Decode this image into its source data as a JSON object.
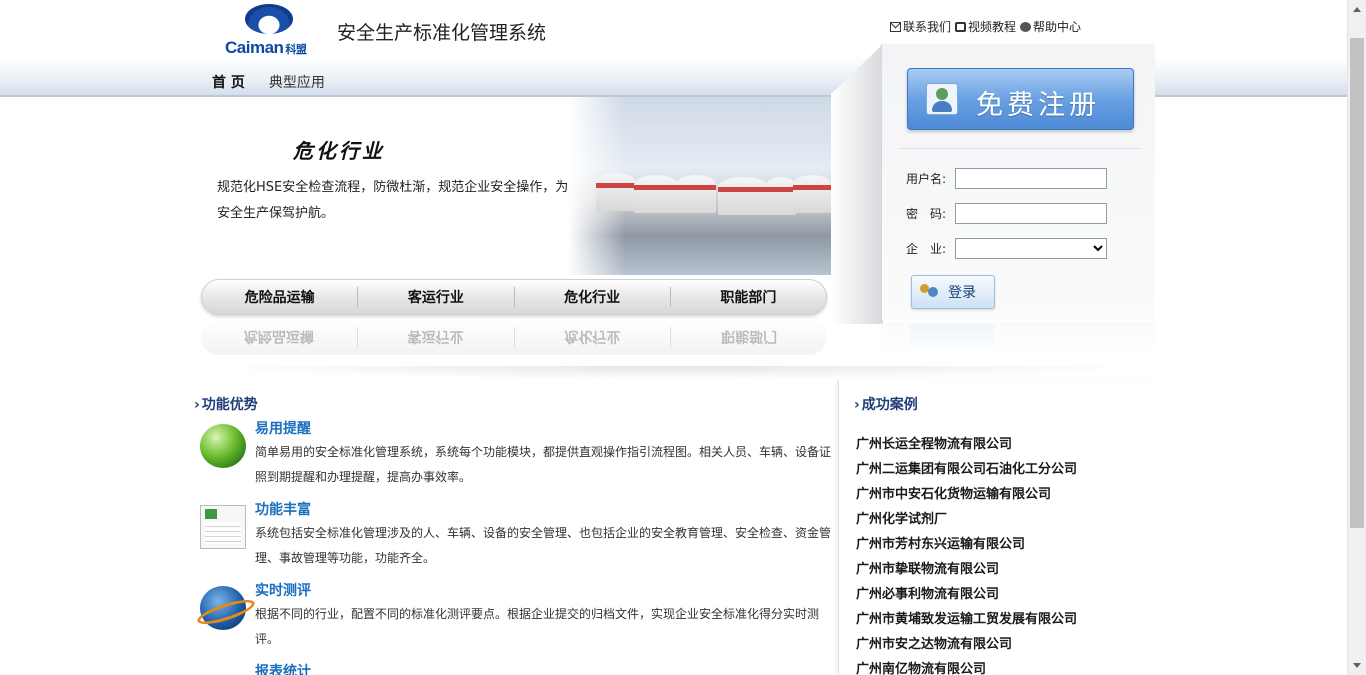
{
  "header": {
    "logo_text": "Caiman",
    "logo_cn": "科盟",
    "site_title": "安全生产标准化管理系统",
    "nav": [
      "首 页",
      "典型应用"
    ],
    "toplinks": [
      {
        "icon": "mail-icon",
        "label": "联系我们"
      },
      {
        "icon": "video-icon",
        "label": "视频教程"
      },
      {
        "icon": "help-icon",
        "label": "帮助中心"
      }
    ]
  },
  "banner": {
    "heading": "危化行业",
    "desc": "规范化HSE安全检查流程，防微杜渐，规范企业安全操作，为安全生产保驾护航。",
    "tabs": [
      "危险品运输",
      "客运行业",
      "危化行业",
      "职能部门"
    ]
  },
  "login": {
    "register_label": "免费注册",
    "username_label": "用户名:",
    "password_label": "密　码:",
    "company_label": "企　业:",
    "username_value": "",
    "password_value": "",
    "company_value": "",
    "login_label": "登录"
  },
  "features": {
    "title": "功能优势",
    "items": [
      {
        "icon": "chat-bubble-icon",
        "title": "易用提醒",
        "text": "简单易用的安全标准化管理系统，系统每个功能模块，都提供直观操作指引流程图。相关人员、车辆、设备证照到期提醒和办理提醒，提高办事效率。"
      },
      {
        "icon": "spreadsheet-icon",
        "title": "功能丰富",
        "text": "系统包括安全标准化管理涉及的人、车辆、设备的安全管理、也包括企业的安全教育管理、安全检查、资金管理、事故管理等功能，功能齐全。"
      },
      {
        "icon": "globe-icon",
        "title": "实时测评",
        "text": "根据不同的行业，配置不同的标准化测评要点。根据企业提交的归档文件，实现企业安全标准化得分实时测评。"
      },
      {
        "icon": "report-icon",
        "title": "报表统计",
        "text": ""
      }
    ]
  },
  "cases": {
    "title": "成功案例",
    "items": [
      "广州长运全程物流有限公司",
      "广州二运集团有限公司石油化工分公司",
      "广州市中安石化货物运输有限公司",
      "广州化学试剂厂",
      "广州市芳村东兴运输有限公司",
      "广州市挚联物流有限公司",
      "广州必事利物流有限公司",
      "广州市黄埔致发运输工贸发展有限公司",
      "广州市安之达物流有限公司",
      "广州南亿物流有限公司"
    ]
  }
}
